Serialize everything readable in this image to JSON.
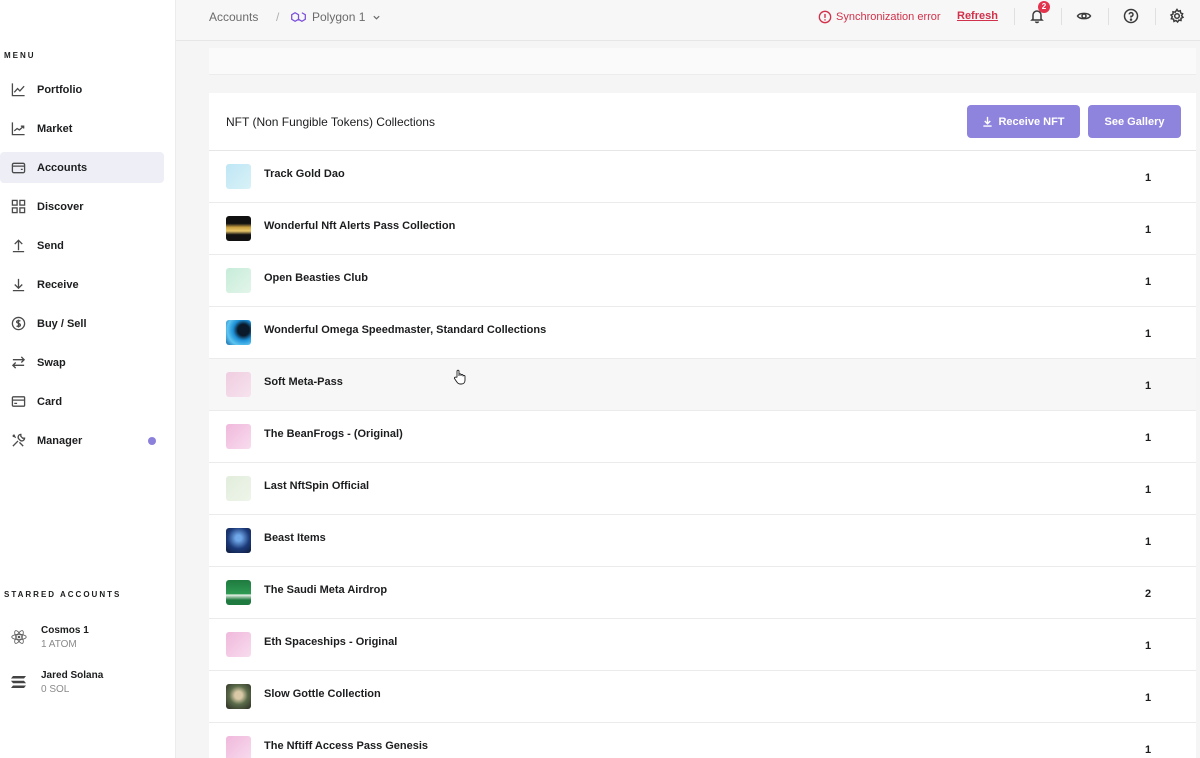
{
  "sidebar": {
    "menu_title": "MENU",
    "items": [
      {
        "label": "Portfolio",
        "icon": "chart-line-icon"
      },
      {
        "label": "Market",
        "icon": "market-chart-icon"
      },
      {
        "label": "Accounts",
        "icon": "wallet-icon",
        "active": true
      },
      {
        "label": "Discover",
        "icon": "grid-icon"
      },
      {
        "label": "Send",
        "icon": "arrow-up-icon"
      },
      {
        "label": "Receive",
        "icon": "arrow-down-icon"
      },
      {
        "label": "Buy / Sell",
        "icon": "dollar-icon"
      },
      {
        "label": "Swap",
        "icon": "swap-icon"
      },
      {
        "label": "Card",
        "icon": "card-icon"
      },
      {
        "label": "Manager",
        "icon": "tools-icon",
        "has_dot": true
      }
    ],
    "starred_title": "STARRED ACCOUNTS",
    "starred": [
      {
        "name": "Cosmos 1",
        "balance": "1 ATOM",
        "icon": "cosmos-icon"
      },
      {
        "name": "Jared Solana",
        "balance": "0 SOL",
        "icon": "solana-icon"
      }
    ]
  },
  "topbar": {
    "breadcrumb_root": "Accounts",
    "breadcrumb_sep": "/",
    "account_name": "Polygon 1",
    "sync_error": "Synchronization error",
    "refresh_label": "Refresh",
    "notification_count": "2"
  },
  "panel": {
    "title": "NFT (Non Fungible Tokens) Collections",
    "receive_label": "Receive NFT",
    "gallery_label": "See Gallery",
    "collections": [
      {
        "name": "Track Gold Dao",
        "count": "1",
        "thumb": "linear-gradient(135deg,#bfe6f5,#d8f2f7)"
      },
      {
        "name": "Wonderful Nft Alerts Pass Collection",
        "count": "1",
        "thumb": "linear-gradient(180deg,#111 0%,#111 30%,#c9a040 45%,#e8c66a 60%,#111 75%)"
      },
      {
        "name": "Open Beasties Club",
        "count": "1",
        "thumb": "linear-gradient(135deg,#c7ecd9,#e2f5ea)"
      },
      {
        "name": "Wonderful Omega Speedmaster, Standard Collections",
        "count": "1",
        "thumb": "radial-gradient(circle at 70% 40%,#0a1a2a 25%,#1c8fd6 45%,#5fc6f0 70%,#1366a8 100%)"
      },
      {
        "name": "Soft Meta-Pass",
        "count": "1",
        "thumb": "linear-gradient(135deg,#efcde0,#f7e3ee)",
        "hover": true
      },
      {
        "name": "The BeanFrogs - (Original)",
        "count": "1",
        "thumb": "linear-gradient(135deg,#f0b8dc,#f8dcee)"
      },
      {
        "name": "Last NftSpin Official",
        "count": "1",
        "thumb": "linear-gradient(135deg,#e2eddc,#eef5ea)"
      },
      {
        "name": "Beast Items",
        "count": "1",
        "thumb": "radial-gradient(circle at 50% 40%,#6fa7e8 15%,#1d3b7a 55%,#0c1a3a 100%)"
      },
      {
        "name": "The Saudi Meta Airdrop",
        "count": "2",
        "thumb": "linear-gradient(180deg,#1f7a3f 0%,#2e9a52 55%,#e8f2e8 60%,#1f7a3f 80%)"
      },
      {
        "name": "Eth Spaceships - Original",
        "count": "1",
        "thumb": "linear-gradient(135deg,#f0b8dc,#f8dcee)"
      },
      {
        "name": "Slow Gottle Collection",
        "count": "1",
        "thumb": "radial-gradient(circle at 50% 45%,#d9c9a6 20%,#5a6b4a 50%,#2b2b22 100%)"
      },
      {
        "name": "The Nftiff Access Pass Genesis",
        "count": "1",
        "thumb": "linear-gradient(135deg,#f0b8dc,#f8dcee)"
      }
    ]
  },
  "colors": {
    "accent": "#8f84dd",
    "error": "#d1314a",
    "active_bg": "#eeeef7"
  }
}
